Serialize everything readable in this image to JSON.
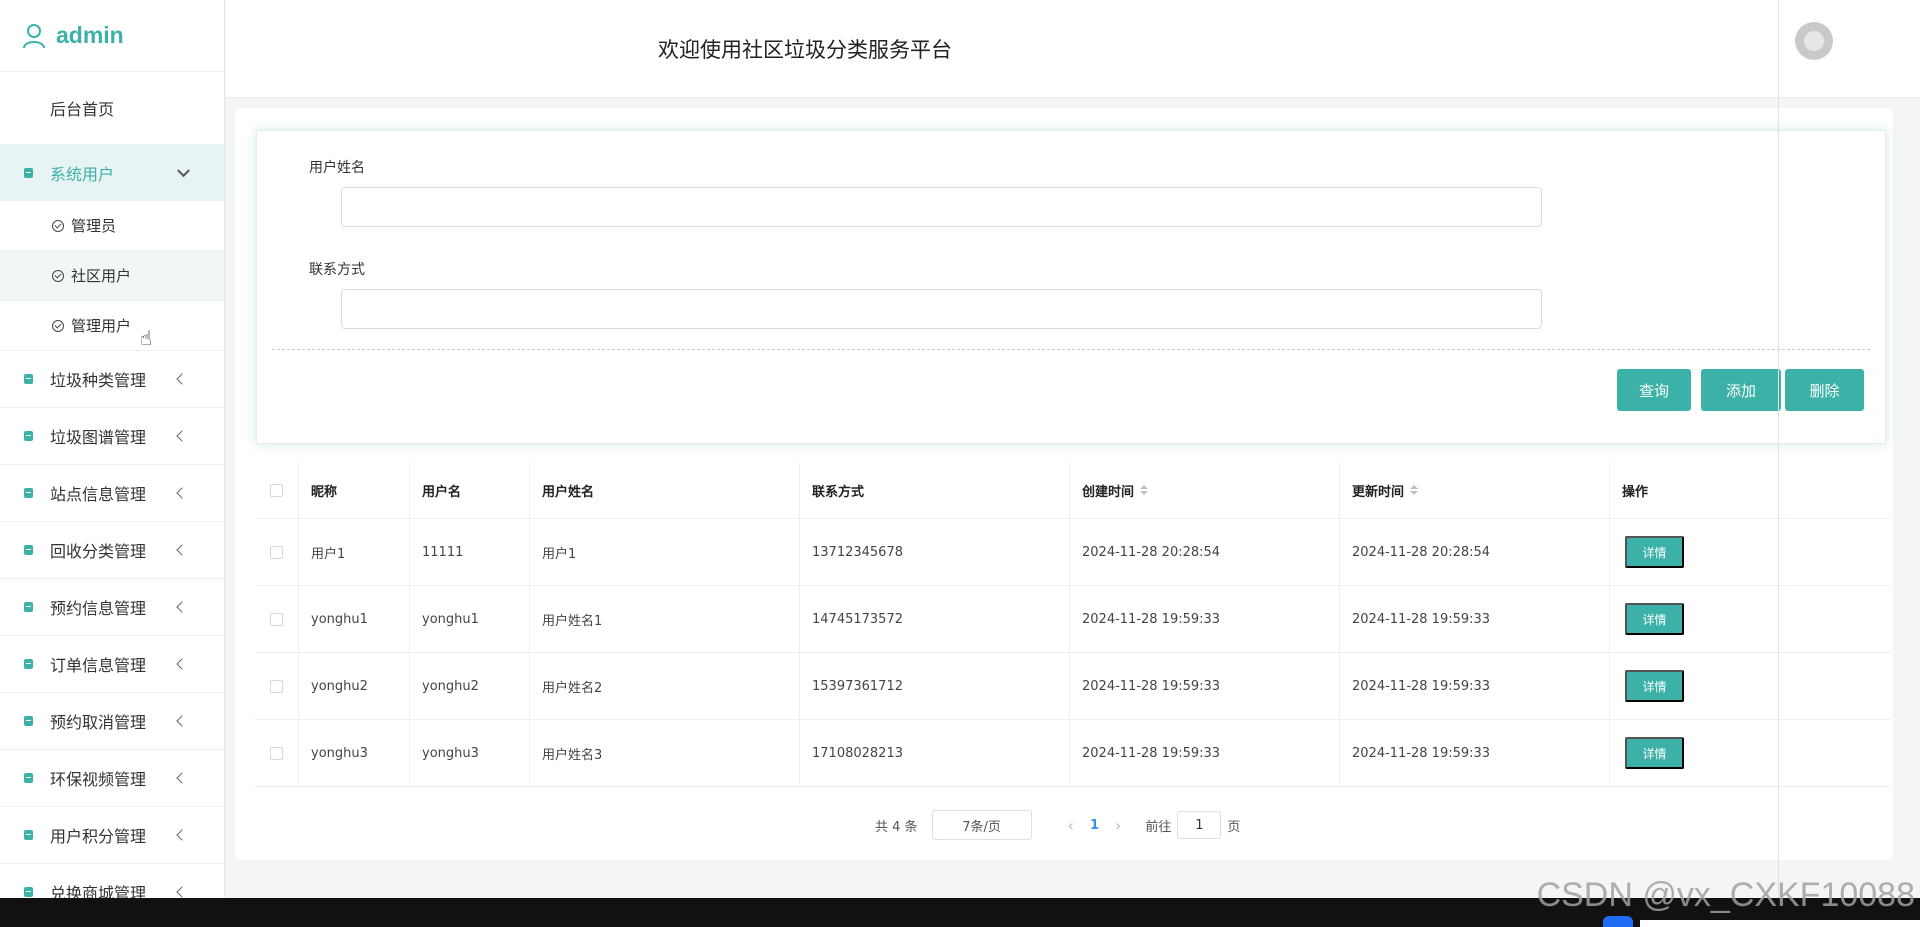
{
  "brand": {
    "name": "admin",
    "icon": "user-icon",
    "color": "#3cb1a8"
  },
  "header": {
    "title": "欢迎使用社区垃圾分类服务平台"
  },
  "sidebar": {
    "home": "后台首页",
    "system_users": {
      "label": "系统用户",
      "children": [
        "管理员",
        "社区用户",
        "管理用户"
      ]
    },
    "menus": [
      "垃圾种类管理",
      "垃圾图谱管理",
      "站点信息管理",
      "回收分类管理",
      "预约信息管理",
      "订单信息管理",
      "预约取消管理",
      "环保视频管理",
      "用户积分管理",
      "兑换商城管理"
    ]
  },
  "search": {
    "field1_label": "用户姓名",
    "field2_label": "联系方式",
    "query_button": "查询",
    "add_button": "添加",
    "delete_button": "删除"
  },
  "table": {
    "headers": [
      "昵称",
      "用户名",
      "用户姓名",
      "联系方式",
      "创建时间",
      "更新时间",
      "操作"
    ],
    "rows": [
      [
        "用户1",
        "11111",
        "用户1",
        "13712345678",
        "2024-11-28 20:28:54",
        "2024-11-28 20:28:54"
      ],
      [
        "yonghu1",
        "yonghu1",
        "用户姓名1",
        "14745173572",
        "2024-11-28 19:59:33",
        "2024-11-28 19:59:33"
      ],
      [
        "yonghu2",
        "yonghu2",
        "用户姓名2",
        "15397361712",
        "2024-11-28 19:59:33",
        "2024-11-28 19:59:33"
      ],
      [
        "yonghu3",
        "yonghu3",
        "用户姓名3",
        "17108028213",
        "2024-11-28 19:59:33",
        "2024-11-28 19:59:33"
      ]
    ],
    "detail_label": "详情"
  },
  "pagination": {
    "total": "共 4 条",
    "page_size": "7条/页",
    "current": "1",
    "goto_prefix": "前往",
    "goto_value": "1",
    "goto_suffix": "页"
  },
  "watermark": "CSDN @vx_CXKF10088"
}
